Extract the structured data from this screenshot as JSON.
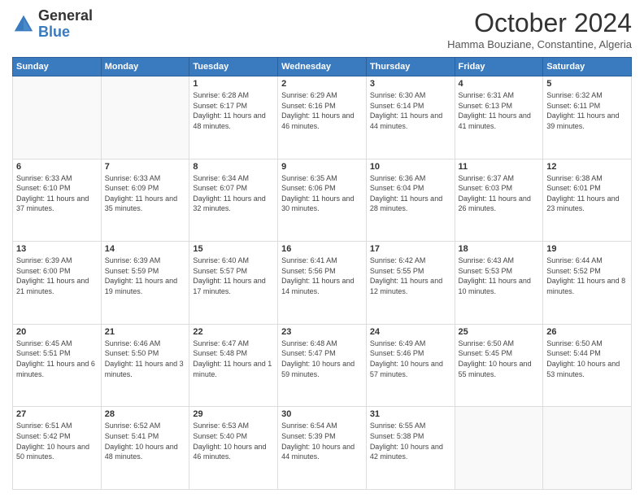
{
  "logo": {
    "general": "General",
    "blue": "Blue"
  },
  "header": {
    "month": "October 2024",
    "location": "Hamma Bouziane, Constantine, Algeria"
  },
  "weekdays": [
    "Sunday",
    "Monday",
    "Tuesday",
    "Wednesday",
    "Thursday",
    "Friday",
    "Saturday"
  ],
  "weeks": [
    [
      {
        "day": "",
        "empty": true
      },
      {
        "day": "",
        "empty": true
      },
      {
        "day": "1",
        "sunrise": "6:28 AM",
        "sunset": "6:17 PM",
        "daylight": "11 hours and 48 minutes."
      },
      {
        "day": "2",
        "sunrise": "6:29 AM",
        "sunset": "6:16 PM",
        "daylight": "11 hours and 46 minutes."
      },
      {
        "day": "3",
        "sunrise": "6:30 AM",
        "sunset": "6:14 PM",
        "daylight": "11 hours and 44 minutes."
      },
      {
        "day": "4",
        "sunrise": "6:31 AM",
        "sunset": "6:13 PM",
        "daylight": "11 hours and 41 minutes."
      },
      {
        "day": "5",
        "sunrise": "6:32 AM",
        "sunset": "6:11 PM",
        "daylight": "11 hours and 39 minutes."
      }
    ],
    [
      {
        "day": "6",
        "sunrise": "6:33 AM",
        "sunset": "6:10 PM",
        "daylight": "11 hours and 37 minutes."
      },
      {
        "day": "7",
        "sunrise": "6:33 AM",
        "sunset": "6:09 PM",
        "daylight": "11 hours and 35 minutes."
      },
      {
        "day": "8",
        "sunrise": "6:34 AM",
        "sunset": "6:07 PM",
        "daylight": "11 hours and 32 minutes."
      },
      {
        "day": "9",
        "sunrise": "6:35 AM",
        "sunset": "6:06 PM",
        "daylight": "11 hours and 30 minutes."
      },
      {
        "day": "10",
        "sunrise": "6:36 AM",
        "sunset": "6:04 PM",
        "daylight": "11 hours and 28 minutes."
      },
      {
        "day": "11",
        "sunrise": "6:37 AM",
        "sunset": "6:03 PM",
        "daylight": "11 hours and 26 minutes."
      },
      {
        "day": "12",
        "sunrise": "6:38 AM",
        "sunset": "6:01 PM",
        "daylight": "11 hours and 23 minutes."
      }
    ],
    [
      {
        "day": "13",
        "sunrise": "6:39 AM",
        "sunset": "6:00 PM",
        "daylight": "11 hours and 21 minutes."
      },
      {
        "day": "14",
        "sunrise": "6:39 AM",
        "sunset": "5:59 PM",
        "daylight": "11 hours and 19 minutes."
      },
      {
        "day": "15",
        "sunrise": "6:40 AM",
        "sunset": "5:57 PM",
        "daylight": "11 hours and 17 minutes."
      },
      {
        "day": "16",
        "sunrise": "6:41 AM",
        "sunset": "5:56 PM",
        "daylight": "11 hours and 14 minutes."
      },
      {
        "day": "17",
        "sunrise": "6:42 AM",
        "sunset": "5:55 PM",
        "daylight": "11 hours and 12 minutes."
      },
      {
        "day": "18",
        "sunrise": "6:43 AM",
        "sunset": "5:53 PM",
        "daylight": "11 hours and 10 minutes."
      },
      {
        "day": "19",
        "sunrise": "6:44 AM",
        "sunset": "5:52 PM",
        "daylight": "11 hours and 8 minutes."
      }
    ],
    [
      {
        "day": "20",
        "sunrise": "6:45 AM",
        "sunset": "5:51 PM",
        "daylight": "11 hours and 6 minutes."
      },
      {
        "day": "21",
        "sunrise": "6:46 AM",
        "sunset": "5:50 PM",
        "daylight": "11 hours and 3 minutes."
      },
      {
        "day": "22",
        "sunrise": "6:47 AM",
        "sunset": "5:48 PM",
        "daylight": "11 hours and 1 minute."
      },
      {
        "day": "23",
        "sunrise": "6:48 AM",
        "sunset": "5:47 PM",
        "daylight": "10 hours and 59 minutes."
      },
      {
        "day": "24",
        "sunrise": "6:49 AM",
        "sunset": "5:46 PM",
        "daylight": "10 hours and 57 minutes."
      },
      {
        "day": "25",
        "sunrise": "6:50 AM",
        "sunset": "5:45 PM",
        "daylight": "10 hours and 55 minutes."
      },
      {
        "day": "26",
        "sunrise": "6:50 AM",
        "sunset": "5:44 PM",
        "daylight": "10 hours and 53 minutes."
      }
    ],
    [
      {
        "day": "27",
        "sunrise": "6:51 AM",
        "sunset": "5:42 PM",
        "daylight": "10 hours and 50 minutes."
      },
      {
        "day": "28",
        "sunrise": "6:52 AM",
        "sunset": "5:41 PM",
        "daylight": "10 hours and 48 minutes."
      },
      {
        "day": "29",
        "sunrise": "6:53 AM",
        "sunset": "5:40 PM",
        "daylight": "10 hours and 46 minutes."
      },
      {
        "day": "30",
        "sunrise": "6:54 AM",
        "sunset": "5:39 PM",
        "daylight": "10 hours and 44 minutes."
      },
      {
        "day": "31",
        "sunrise": "6:55 AM",
        "sunset": "5:38 PM",
        "daylight": "10 hours and 42 minutes."
      },
      {
        "day": "",
        "empty": true
      },
      {
        "day": "",
        "empty": true
      }
    ]
  ]
}
